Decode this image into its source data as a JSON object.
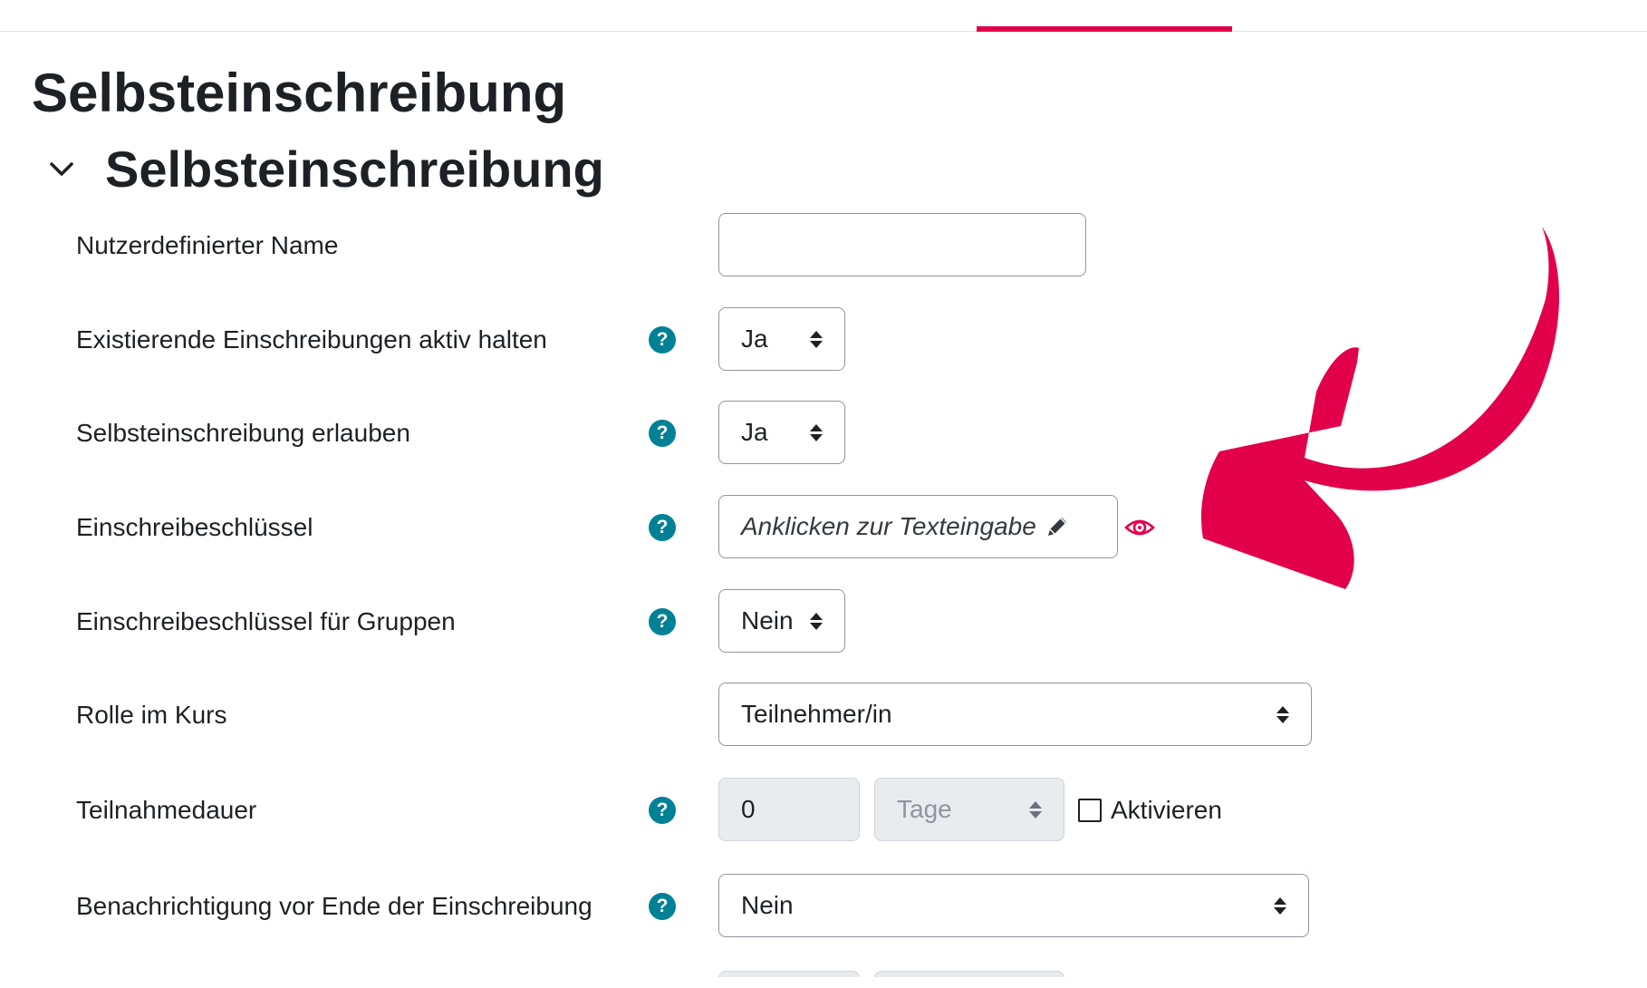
{
  "page": {
    "title": "Selbsteinschreibung"
  },
  "section": {
    "title": "Selbsteinschreibung",
    "chevron_icon": "chevron-down-icon"
  },
  "accent_color": "#e2004a",
  "help_color": "#008196",
  "form": {
    "custom_name": {
      "label": "Nutzerdefinierter Name",
      "value": ""
    },
    "keep_enrolments": {
      "label": "Existierende Einschreibungen aktiv halten",
      "value": "Ja"
    },
    "allow_self_enrol": {
      "label": "Selbsteinschreibung erlauben",
      "value": "Ja"
    },
    "enrol_key": {
      "label": "Einschreibeschlüssel",
      "placeholder": "Anklicken zur Texteingabe",
      "edit_icon": "pencil-icon",
      "reveal_icon": "eye-icon"
    },
    "group_key": {
      "label": "Einschreibeschlüssel für Gruppen",
      "value": "Nein"
    },
    "course_role": {
      "label": "Rolle im Kurs",
      "value": "Teilnehmer/in"
    },
    "duration": {
      "label": "Teilnahmedauer",
      "number": "0",
      "unit": "Tage",
      "enable_label": "Aktivieren"
    },
    "notify_before_end": {
      "label": "Benachrichtigung vor Ende der Einschreibung",
      "value": "Nein"
    }
  },
  "help_icon": {
    "glyph": "?",
    "name": "help-icon"
  }
}
